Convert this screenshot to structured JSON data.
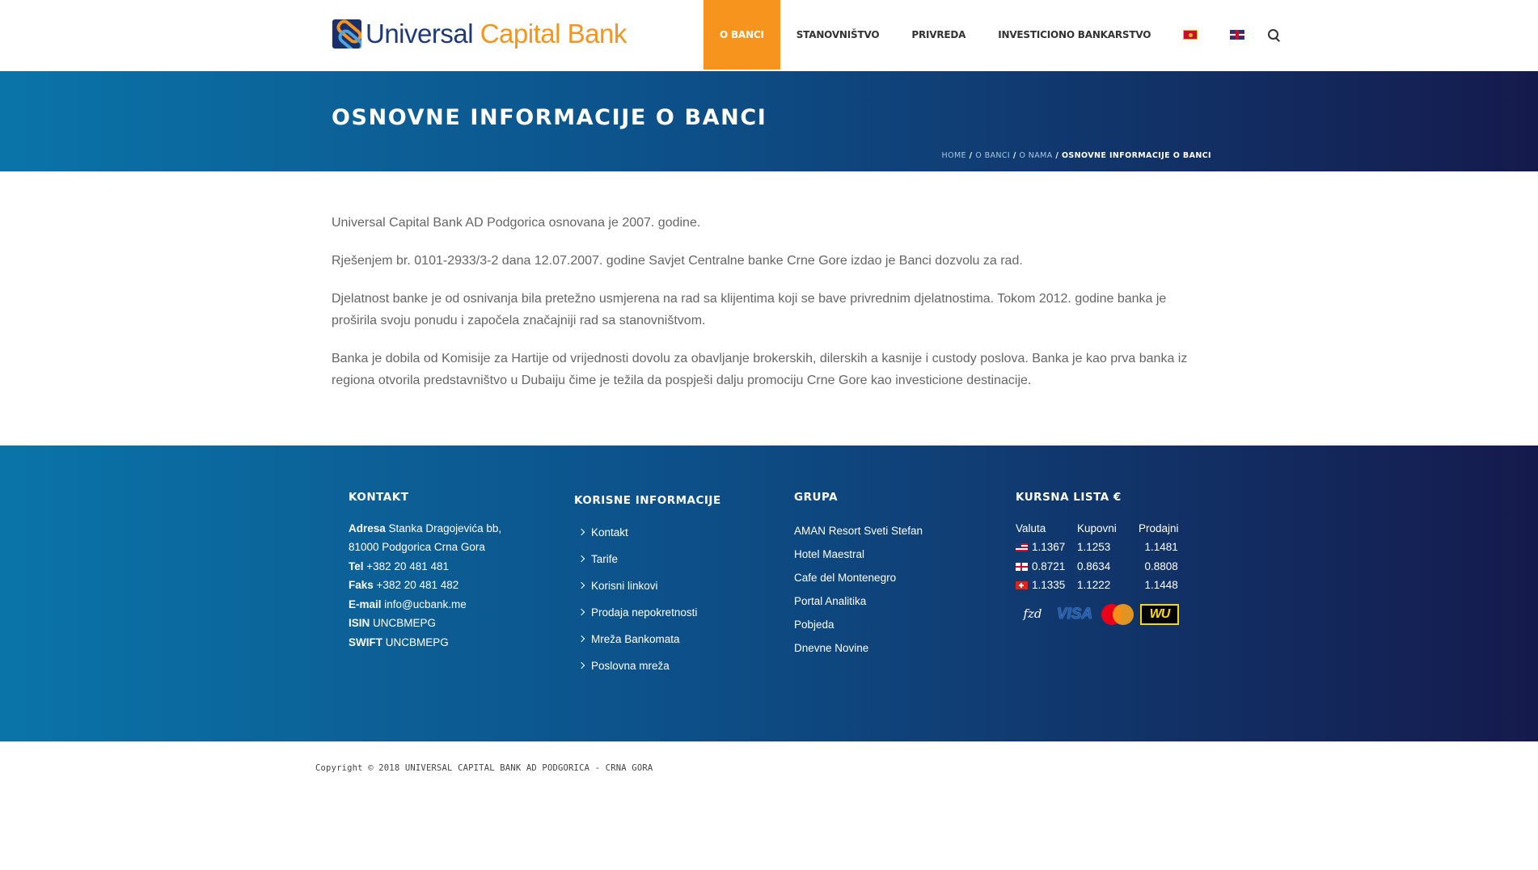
{
  "logo": {
    "word1": "Universal",
    "word2": "Capital Bank"
  },
  "nav": {
    "items": [
      "O BANCI",
      "STANOVNIŠTVO",
      "PRIVREDA",
      "INVESTICIONO BANKARSTVO"
    ],
    "active": "O BANCI",
    "flags": [
      "montenegro-flag-icon",
      "uk-flag-icon"
    ],
    "search_icon": "search-icon",
    "accent": "#f7941d"
  },
  "banner": {
    "title": "OSNOVNE INFORMACIJE O BANCI",
    "breadcrumb": [
      "HOME",
      "O BANCI",
      "O NAMA",
      "OSNOVNE INFORMACIJE O BANCI"
    ],
    "separator": "/"
  },
  "content": {
    "paragraphs": [
      "Universal Capital Bank AD Podgorica osnovana je 2007. godine.",
      "Rješenjem br. 0101-2933/3-2 dana 12.07.2007. godine Savjet Centralne banke Crne Gore izdao je Banci dozvolu za rad.",
      "Djelatnost banke je od osnivanja bila pretežno usmjerena na rad sa klijentima koji se bave privrednim djelatnostima. Tokom 2012. godine banka je proširila svoju ponudu i započela značajniji rad sa stanovništvom.",
      "Banka je dobila od Komisije za Hartije od vrijednosti dovolu za obavljanje brokerskih, dilerskih a kasnije i custody poslova. Banka je kao prva banka iz regiona otvorila predstavništvo u Dubaiju čime je težila da pospješi dalju promociju Crne Gore kao investicione destinacije."
    ]
  },
  "footer": {
    "contact": {
      "title": "KONTAKT",
      "address_label": "Adresa",
      "address_line1": "Stanka Dragojevića bb,",
      "address_line2": "81000 Podgorica Crna Gora",
      "tel_label": "Tel",
      "tel": "+382 20 481 481",
      "fax_label": "Faks",
      "fax": "+382 20 481 482",
      "email_label": "E-mail",
      "email": "info@ucbank.me",
      "isin_label": "ISIN",
      "isin": "UNCBMEPG",
      "swift_label": "SWIFT",
      "swift": "UNCBMEPG"
    },
    "info": {
      "title": "KORISNE INFORMACIJE",
      "links": [
        "Kontakt",
        "Tarife",
        "Korisni linkovi",
        "Prodaja nepokretnosti",
        "Mreža Bankomata",
        "Poslovna mreža"
      ]
    },
    "group": {
      "title": "GRUPA",
      "links": [
        "AMAN Resort Sveti Stefan",
        "Hotel Maestral",
        "Cafe del Montenegro",
        "Portal Analitika",
        "Pobjeda",
        "Dnevne Novine"
      ]
    },
    "rates": {
      "title": "KURSNA LISTA €",
      "headers": [
        "Valuta",
        "Kupovni",
        "Prodajni"
      ],
      "rows": [
        {
          "flag": "us-flag-icon",
          "valuta": "1.1367",
          "kupovni": "1.1253",
          "prodajni": "1.1481"
        },
        {
          "flag": "gb-flag-icon",
          "valuta": "0.8721",
          "kupovni": "0.8634",
          "prodajni": "0.8808"
        },
        {
          "flag": "ch-flag-icon",
          "valuta": "1.1335",
          "kupovni": "1.1222",
          "prodajni": "1.1448"
        }
      ],
      "cards": {
        "fzd": "fzd",
        "visa": "VISA",
        "mastercard": "mastercard-logo-icon",
        "wu": "WU"
      }
    }
  },
  "copyright": "Copyright © 2018 UNIVERSAL CAPITAL BANK AD PODGORICA - CRNA GORA"
}
